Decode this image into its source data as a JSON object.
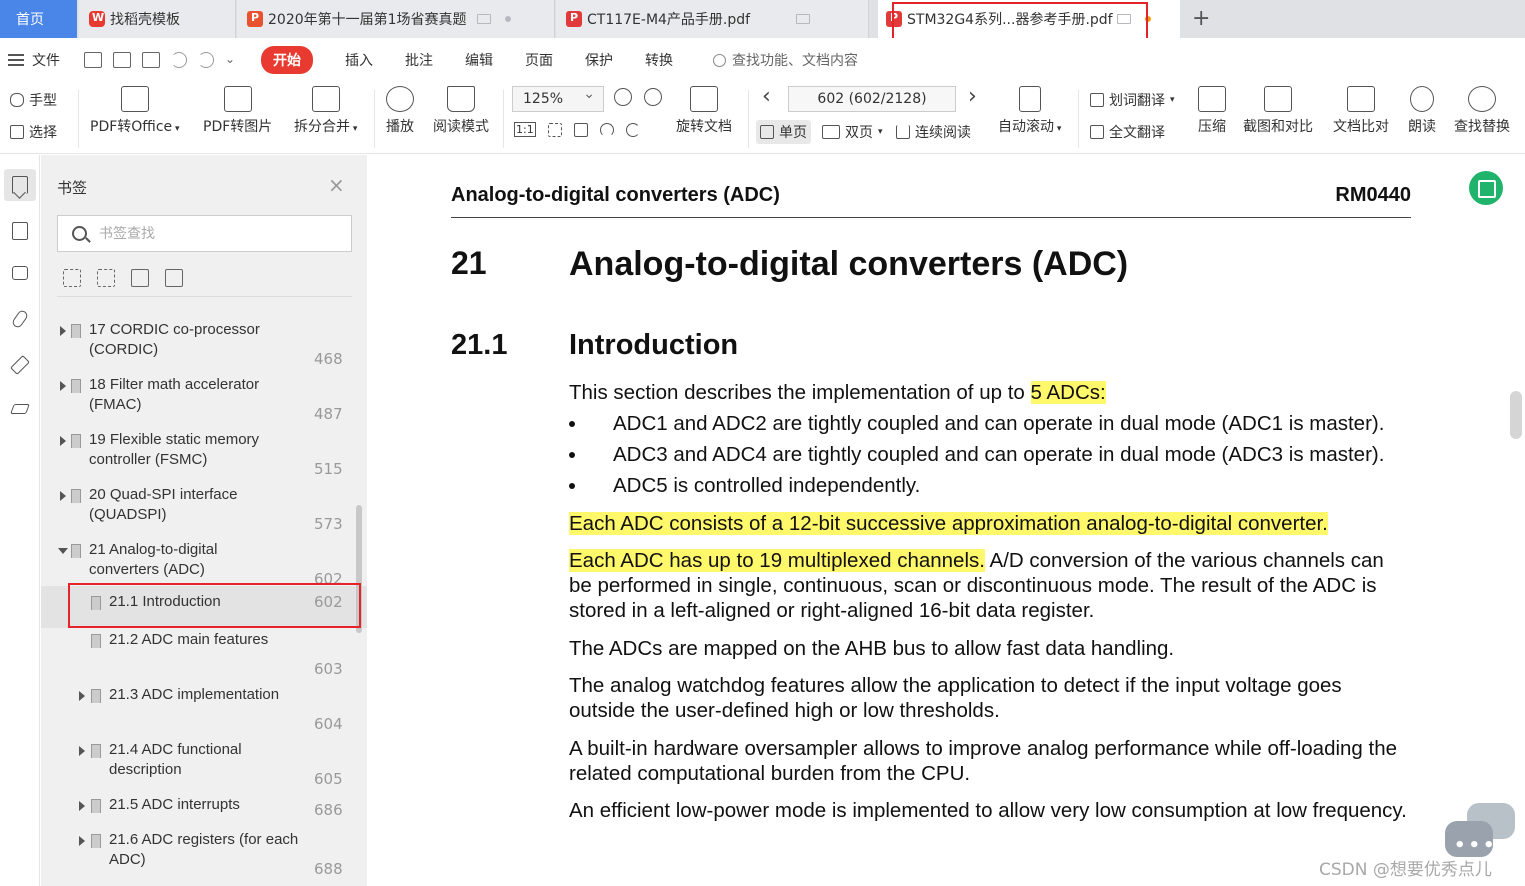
{
  "tabs": {
    "home": "首页",
    "items": [
      {
        "label": "找稻壳模板",
        "icon": "wps-icon"
      },
      {
        "label": "2020年第十一届第1场省赛真题",
        "icon": "ppt-icon"
      },
      {
        "label": "CT117E-M4产品手册.pdf",
        "icon": "pdf-icon"
      },
      {
        "label": "STM32G4系列...器参考手册.pdf",
        "icon": "pdf-icon"
      }
    ],
    "add": "+"
  },
  "menubar": {
    "file": "文件",
    "items": [
      "开始",
      "插入",
      "批注",
      "编辑",
      "页面",
      "保护",
      "转换"
    ],
    "search": "查找功能、文档内容"
  },
  "ribbon": {
    "hand": "手型",
    "select": "选择",
    "pdf_office": "PDF转Office",
    "pdf_image": "PDF转图片",
    "split_merge": "拆分合并",
    "play": "播放",
    "read_mode": "阅读模式",
    "zoom": "125%",
    "rotate_doc": "旋转文档",
    "page_indicator": "602 (602/2128)",
    "single": "单页",
    "double": "双页",
    "continuous": "连续阅读",
    "auto_scroll": "自动滚动",
    "word_translate": "划词翻译",
    "full_translate": "全文翻译",
    "compress": "压缩",
    "screenshot_compare": "截图和对比",
    "doc_compare": "文档比对",
    "read_aloud": "朗读",
    "find_replace": "查找替换",
    "fit_label": "1:1"
  },
  "panel": {
    "title": "书签",
    "search_placeholder": "书签查找",
    "items": [
      {
        "label": "17 CORDIC co-processor (CORDIC)",
        "page": "468",
        "level": 0,
        "arrow": "closed"
      },
      {
        "label": "18 Filter math accelerator (FMAC)",
        "page": "487",
        "level": 0,
        "arrow": "closed"
      },
      {
        "label": "19 Flexible static memory controller (FSMC)",
        "page": "515",
        "level": 0,
        "arrow": "closed"
      },
      {
        "label": "20 Quad-SPI interface (QUADSPI)",
        "page": "573",
        "level": 0,
        "arrow": "closed"
      },
      {
        "label": "21 Analog-to-digital converters (ADC)",
        "page": "602",
        "level": 0,
        "arrow": "open"
      },
      {
        "label": "21.1 Introduction",
        "page": "602",
        "level": 1,
        "arrow": "none",
        "selected": true
      },
      {
        "label": "21.2 ADC main features",
        "page": "603",
        "level": 1,
        "arrow": "none"
      },
      {
        "label": "21.3 ADC implementation",
        "page": "604",
        "level": 1,
        "arrow": "closed"
      },
      {
        "label": "21.4 ADC functional description",
        "page": "605",
        "level": 1,
        "arrow": "closed"
      },
      {
        "label": "21.5 ADC interrupts",
        "page": "686",
        "level": 1,
        "arrow": "closed"
      },
      {
        "label": "21.6 ADC registers (for each ADC)",
        "page": "688",
        "level": 1,
        "arrow": "closed"
      }
    ]
  },
  "document": {
    "header_left": "Analog-to-digital converters (ADC)",
    "header_right": "RM0440",
    "chapter_number": "21",
    "chapter_title": "Analog-to-digital converters (ADC)",
    "section_number": "21.1",
    "section_title": "Introduction",
    "intro_prefix": "This section describes the implementation of up to ",
    "intro_highlight": "5 ADCs:",
    "bullets": [
      "ADC1 and ADC2 are tightly coupled and can operate in dual mode (ADC1 is master).",
      "ADC3 and ADC4 are tightly coupled and can operate in dual mode (ADC3 is master).",
      "ADC5 is controlled independently."
    ],
    "para1_highlight": "Each ADC consists of a 12-bit successive approximation analog-to-digital converter.",
    "para2_highlight": "Each ADC has up to 19 multiplexed channels.",
    "para2_rest": " A/D conversion of the various channels can be performed in single, continuous, scan or discontinuous mode. The result of the ADC is stored in a left-aligned or right-aligned 16-bit data register.",
    "para3": "The ADCs are mapped on the AHB bus to allow fast data handling.",
    "para4": "The analog watchdog features allow the application to detect if the input voltage goes outside the user-defined high or low thresholds.",
    "para5": "A built-in hardware oversampler allows to improve analog performance while off-loading the related computational burden from the CPU.",
    "para6": "An efficient low-power mode is implemented to allow very low consumption at low frequency."
  },
  "watermark": "CSDN @想要优秀点儿",
  "colors": {
    "accent": "#e83a30",
    "home_tab": "#4a86e8",
    "highlight_box": "#e3242b",
    "text_highlight": "#fff86b"
  }
}
